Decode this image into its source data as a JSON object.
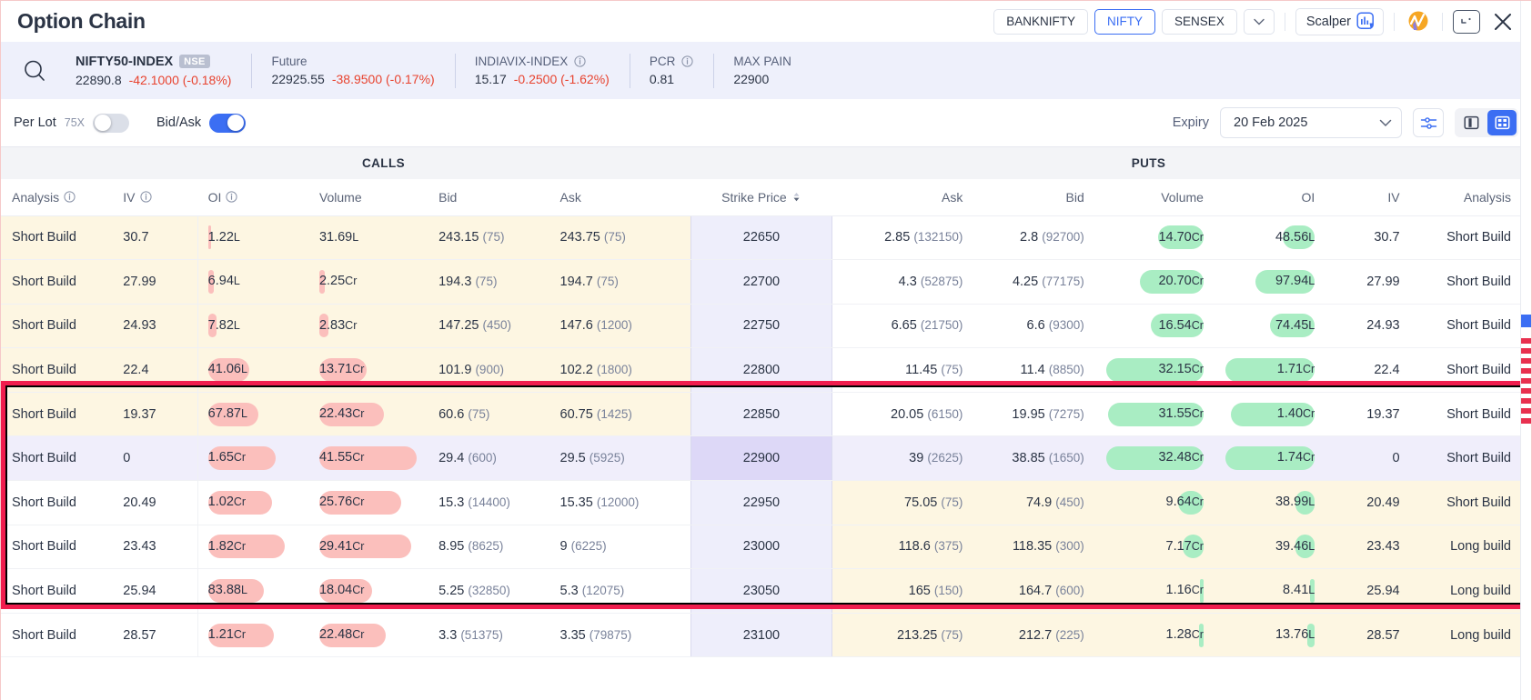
{
  "window": {
    "title": "Option Chain",
    "index_tabs": [
      {
        "label": "BANKNIFTY",
        "active": false
      },
      {
        "label": "NIFTY",
        "active": true
      },
      {
        "label": "SENSEX",
        "active": false
      }
    ],
    "more_label": "chevron-down-icon",
    "scalper_label": "Scalper",
    "close_label": "✕"
  },
  "info": {
    "symbol": "NIFTY50-INDEX",
    "exchange_badge": "NSE",
    "symbol_price": "22890.8",
    "symbol_change": "-42.1000 (-0.18%)",
    "future_label": "Future",
    "future_price": "22925.55",
    "future_change": "-38.9500 (-0.17%)",
    "vix_label": "INDIAVIX-INDEX",
    "vix_price": "15.17",
    "vix_change": "-0.2500 (-1.62%)",
    "pcr_label": "PCR",
    "pcr_value": "0.81",
    "maxpain_label": "MAX PAIN",
    "maxpain_value": "22900"
  },
  "controls": {
    "per_lot_label": "Per Lot",
    "per_lot_multiplier": "75X",
    "per_lot_on": false,
    "bid_ask_label": "Bid/Ask",
    "bid_ask_on": true,
    "expiry_label": "Expiry",
    "expiry_value": "20 Feb 2025"
  },
  "sections": {
    "calls": "CALLS",
    "puts": "PUTS"
  },
  "columns": {
    "call_analysis": "Analysis",
    "call_iv": "IV",
    "call_oi": "OI",
    "call_volume": "Volume",
    "call_bid": "Bid",
    "call_ask": "Ask",
    "strike": "Strike Price",
    "put_ask": "Ask",
    "put_bid": "Bid",
    "put_volume": "Volume",
    "put_oi": "OI",
    "put_iv": "IV",
    "put_analysis": "Analysis"
  },
  "colors": {
    "accent": "#3b6ef3",
    "negative": "#e8432f",
    "call_bar": "#fbbfbc",
    "put_bar": "#a9edc3",
    "itm_bg": "#fdf6e2",
    "strike_bg": "#eeeefb",
    "atm_bg": "#ddd8f7",
    "selection": "#f01d4e"
  },
  "rows": [
    {
      "strike": "22650",
      "atm": false,
      "selected": false,
      "call_itm": true,
      "call": {
        "analysis": "Short Build",
        "iv": "30.7",
        "oi": "1.22",
        "oi_unit": "L",
        "oi_bar": 3,
        "volume": "31.69",
        "volume_unit": "L",
        "volume_bar": 0,
        "bid": "243.15",
        "bid_qty": "(75)",
        "ask": "243.75",
        "ask_qty": "(75)"
      },
      "put": {
        "ask": "2.85",
        "ask_qty": "(132150)",
        "bid": "2.8",
        "bid_qty": "(92700)",
        "volume": "14.70",
        "volume_unit": "Cr",
        "volume_bar": 47,
        "oi": "48.56",
        "oi_unit": "L",
        "oi_bar": 36,
        "iv": "30.7",
        "analysis": "Short Build"
      }
    },
    {
      "strike": "22700",
      "atm": false,
      "selected": false,
      "call_itm": true,
      "call": {
        "analysis": "Short Build",
        "iv": "27.99",
        "oi": "6.94",
        "oi_unit": "L",
        "oi_bar": 6,
        "volume": "2.25",
        "volume_unit": "Cr",
        "volume_bar": 6,
        "bid": "194.3",
        "bid_qty": "(75)",
        "ask": "194.7",
        "ask_qty": "(75)"
      },
      "put": {
        "ask": "4.3",
        "ask_qty": "(52875)",
        "bid": "4.25",
        "bid_qty": "(77175)",
        "volume": "20.70",
        "volume_unit": "Cr",
        "volume_bar": 65,
        "oi": "97.94",
        "oi_unit": "L",
        "oi_bar": 66,
        "iv": "27.99",
        "analysis": "Short Build"
      }
    },
    {
      "strike": "22750",
      "atm": false,
      "selected": false,
      "call_itm": true,
      "call": {
        "analysis": "Short Build",
        "iv": "24.93",
        "oi": "7.82",
        "oi_unit": "L",
        "oi_bar": 10,
        "volume": "2.83",
        "volume_unit": "Cr",
        "volume_bar": 9,
        "bid": "147.25",
        "bid_qty": "(450)",
        "ask": "147.6",
        "ask_qty": "(1200)"
      },
      "put": {
        "ask": "6.65",
        "ask_qty": "(21750)",
        "bid": "6.6",
        "bid_qty": "(9300)",
        "volume": "16.54",
        "volume_unit": "Cr",
        "volume_bar": 54,
        "oi": "74.45",
        "oi_unit": "L",
        "oi_bar": 50,
        "iv": "24.93",
        "analysis": "Short Build"
      }
    },
    {
      "strike": "22800",
      "atm": false,
      "selected": true,
      "call_itm": true,
      "call": {
        "analysis": "Short Build",
        "iv": "22.4",
        "oi": "41.06",
        "oi_unit": "L",
        "oi_bar": 46,
        "volume": "13.71",
        "volume_unit": "Cr",
        "volume_bar": 49,
        "bid": "101.9",
        "bid_qty": "(900)",
        "ask": "102.2",
        "ask_qty": "(1800)"
      },
      "put": {
        "ask": "11.45",
        "ask_qty": "(75)",
        "bid": "11.4",
        "bid_qty": "(8850)",
        "volume": "32.15",
        "volume_unit": "Cr",
        "volume_bar": 100,
        "oi": "1.71",
        "oi_unit": "Cr",
        "oi_bar": 100,
        "iv": "22.4",
        "analysis": "Short Build"
      }
    },
    {
      "strike": "22850",
      "atm": false,
      "selected": true,
      "call_itm": true,
      "call": {
        "analysis": "Short Build",
        "iv": "19.37",
        "oi": "67.87",
        "oi_unit": "L",
        "oi_bar": 56,
        "volume": "22.43",
        "volume_unit": "Cr",
        "volume_bar": 66,
        "bid": "60.6",
        "bid_qty": "(75)",
        "ask": "60.75",
        "ask_qty": "(1425)"
      },
      "put": {
        "ask": "20.05",
        "ask_qty": "(6150)",
        "bid": "19.95",
        "bid_qty": "(7275)",
        "volume": "31.55",
        "volume_unit": "Cr",
        "volume_bar": 98,
        "oi": "1.40",
        "oi_unit": "Cr",
        "oi_bar": 94,
        "iv": "19.37",
        "analysis": "Short Build"
      }
    },
    {
      "strike": "22900",
      "atm": true,
      "selected": true,
      "call_itm": true,
      "call": {
        "analysis": "Short Build",
        "iv": "0",
        "oi": "1.65",
        "oi_unit": "Cr",
        "oi_bar": 76,
        "volume": "41.55",
        "volume_unit": "Cr",
        "volume_bar": 100,
        "bid": "29.4",
        "bid_qty": "(600)",
        "ask": "29.5",
        "ask_qty": "(5925)"
      },
      "put": {
        "ask": "39",
        "ask_qty": "(2625)",
        "bid": "38.85",
        "bid_qty": "(1650)",
        "volume": "32.48",
        "volume_unit": "Cr",
        "volume_bar": 100,
        "oi": "1.74",
        "oi_unit": "Cr",
        "oi_bar": 100,
        "iv": "0",
        "analysis": "Short Build"
      }
    },
    {
      "strike": "22950",
      "atm": false,
      "selected": true,
      "call_itm": false,
      "call": {
        "analysis": "Short Build",
        "iv": "20.49",
        "oi": "1.02",
        "oi_unit": "Cr",
        "oi_bar": 72,
        "volume": "25.76",
        "volume_unit": "Cr",
        "volume_bar": 84,
        "bid": "15.3",
        "bid_qty": "(14400)",
        "ask": "15.35",
        "ask_qty": "(12000)"
      },
      "put": {
        "ask": "75.05",
        "ask_qty": "(75)",
        "bid": "74.9",
        "bid_qty": "(450)",
        "volume": "9.64",
        "volume_unit": "Cr",
        "volume_bar": 26,
        "oi": "38.99",
        "oi_unit": "L",
        "oi_bar": 22,
        "iv": "20.49",
        "analysis": "Short Build"
      }
    },
    {
      "strike": "23000",
      "atm": false,
      "selected": true,
      "call_itm": false,
      "call": {
        "analysis": "Short Build",
        "iv": "23.43",
        "oi": "1.82",
        "oi_unit": "Cr",
        "oi_bar": 86,
        "volume": "29.41",
        "volume_unit": "Cr",
        "volume_bar": 94,
        "bid": "8.95",
        "bid_qty": "(8625)",
        "ask": "9",
        "ask_qty": "(6225)"
      },
      "put": {
        "ask": "118.6",
        "ask_qty": "(375)",
        "bid": "118.35",
        "bid_qty": "(300)",
        "volume": "7.17",
        "volume_unit": "Cr",
        "volume_bar": 21,
        "oi": "39.46",
        "oi_unit": "L",
        "oi_bar": 22,
        "iv": "23.43",
        "analysis": "Long build"
      }
    },
    {
      "strike": "23050",
      "atm": false,
      "selected": false,
      "call_itm": false,
      "call": {
        "analysis": "Short Build",
        "iv": "25.94",
        "oi": "83.88",
        "oi_unit": "L",
        "oi_bar": 62,
        "volume": "18.04",
        "volume_unit": "Cr",
        "volume_bar": 54,
        "bid": "5.25",
        "bid_qty": "(32850)",
        "ask": "5.3",
        "ask_qty": "(12075)"
      },
      "put": {
        "ask": "165",
        "ask_qty": "(150)",
        "bid": "164.7",
        "bid_qty": "(600)",
        "volume": "1.16",
        "volume_unit": "Cr",
        "volume_bar": 4,
        "oi": "8.41",
        "oi_unit": "L",
        "oi_bar": 5,
        "iv": "25.94",
        "analysis": "Long build"
      }
    },
    {
      "strike": "23100",
      "atm": false,
      "selected": false,
      "call_itm": false,
      "call": {
        "analysis": "Short Build",
        "iv": "28.57",
        "oi": "1.21",
        "oi_unit": "Cr",
        "oi_bar": 74,
        "volume": "22.48",
        "volume_unit": "Cr",
        "volume_bar": 68,
        "bid": "3.3",
        "bid_qty": "(51375)",
        "ask": "3.35",
        "ask_qty": "(79875)"
      },
      "put": {
        "ask": "213.25",
        "ask_qty": "(75)",
        "bid": "212.7",
        "bid_qty": "(225)",
        "volume": "1.28",
        "volume_unit": "Cr",
        "volume_bar": 5,
        "oi": "13.76",
        "oi_unit": "L",
        "oi_bar": 8,
        "iv": "28.57",
        "analysis": "Long build"
      }
    }
  ]
}
